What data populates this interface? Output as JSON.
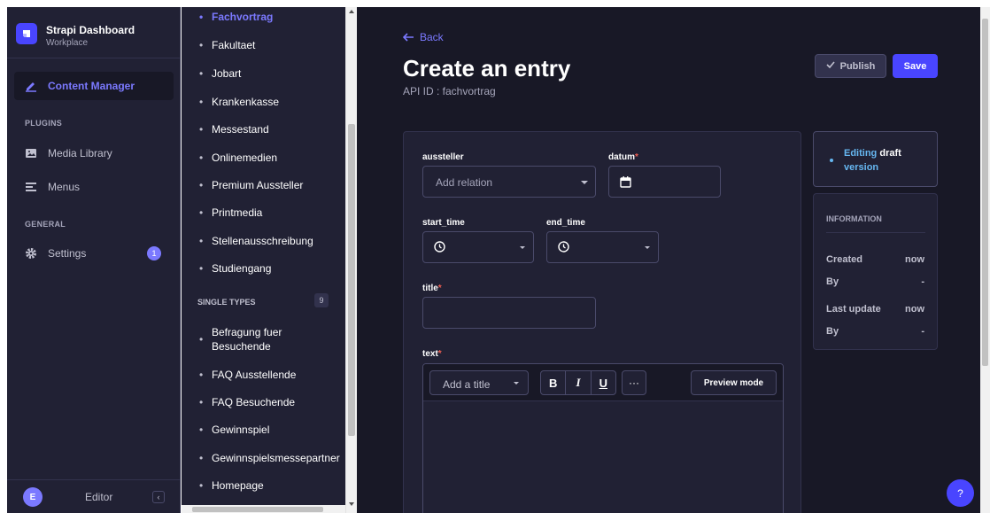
{
  "brand": {
    "title": "Strapi Dashboard",
    "subtitle": "Workplace"
  },
  "mainnav": {
    "content_manager": "Content Manager",
    "plugins_section": "PLUGINS",
    "media_library": "Media Library",
    "menus": "Menus",
    "general_section": "GENERAL",
    "settings": "Settings",
    "settings_badge": "1"
  },
  "footer": {
    "avatar_initial": "E",
    "user": "Editor"
  },
  "subnav": {
    "collection_items": [
      "Fachvortrag",
      "Fakultaet",
      "Jobart",
      "Krankenkasse",
      "Messestand",
      "Onlinemedien",
      "Premium Aussteller",
      "Printmedia",
      "Stellenausschreibung",
      "Studiengang"
    ],
    "single_types_section": "SINGLE TYPES",
    "single_types_count": "9",
    "single_items": [
      "Befragung fuer Besuchende",
      "FAQ Ausstellende",
      "FAQ Besuchende",
      "Gewinnspiel",
      "Gewinnspielsmessepartner",
      "Homepage"
    ]
  },
  "header": {
    "back": "Back",
    "title": "Create an entry",
    "api_id": "API ID : fachvortrag",
    "publish": "Publish",
    "save": "Save"
  },
  "form": {
    "aussteller_label": "aussteller",
    "aussteller_placeholder": "Add relation",
    "datum_label": "datum",
    "start_time_label": "start_time",
    "end_time_label": "end_time",
    "title_label": "title",
    "text_label": "text",
    "required_mark": "*",
    "editor": {
      "title_select": "Add a title",
      "bold": "B",
      "italic": "I",
      "underline": "U",
      "more": "···",
      "preview": "Preview mode"
    }
  },
  "status": {
    "prefix": "Editing",
    "highlight": "draft",
    "suffix": "version"
  },
  "information": {
    "heading": "INFORMATION",
    "created": "Created",
    "created_value": "now",
    "by1": "By",
    "by1_value": "-",
    "last_update": "Last update",
    "last_update_value": "now",
    "by2": "By",
    "by2_value": "-"
  },
  "help": "?",
  "colors": {
    "accent": "#4945ff",
    "accent_light": "#7b79ff",
    "bg_dark": "#181826",
    "panel": "#212134",
    "required": "#ee5e52",
    "info_blue": "#66b7f1"
  }
}
